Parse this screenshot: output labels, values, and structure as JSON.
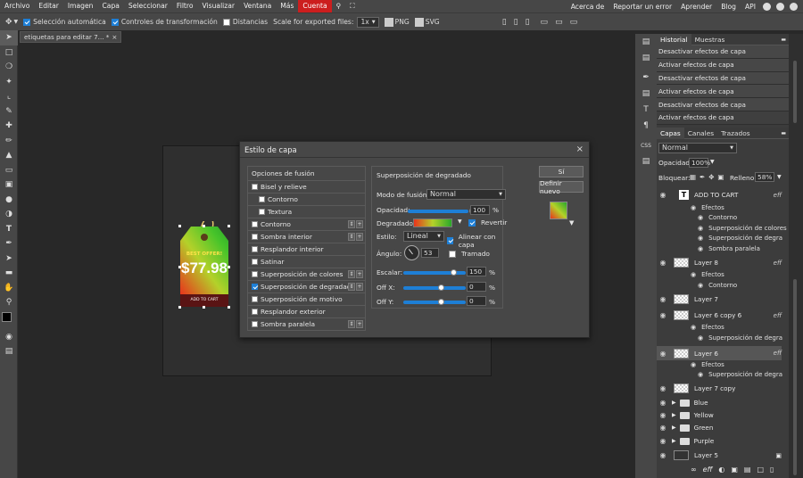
{
  "menu": [
    "Archivo",
    "Editar",
    "Imagen",
    "Capa",
    "Seleccionar",
    "Filtro",
    "Visualizar",
    "Ventana",
    "Más"
  ],
  "menu_highlight": "Cuenta",
  "menu_right": [
    "Acerca de",
    "Reportar un error",
    "Aprender",
    "Blog",
    "API"
  ],
  "options": {
    "auto_select": "Selección automática",
    "transform_controls": "Controles de transformación",
    "distances": "Distancias",
    "scale_label": "Scale for exported files:",
    "scale_value": "1x",
    "png": "PNG",
    "svg": "SVG"
  },
  "doc_tab": "etiquetas para editar 7... *",
  "doc_tab_close": "×",
  "dialog": {
    "title": "Estilo de capa",
    "close": "×",
    "left_header": "Opciones de fusión",
    "left_items": [
      {
        "label": "Bisel y relieve",
        "checked": false,
        "indent": false,
        "pm": false
      },
      {
        "label": "Contorno",
        "checked": false,
        "indent": true,
        "pm": false
      },
      {
        "label": "Textura",
        "checked": false,
        "indent": true,
        "pm": false
      },
      {
        "label": "Contorno",
        "checked": false,
        "indent": false,
        "pm": true
      },
      {
        "label": "Sombra interior",
        "checked": false,
        "indent": false,
        "pm": true
      },
      {
        "label": "Resplandor interior",
        "checked": false,
        "indent": false,
        "pm": false
      },
      {
        "label": "Satinar",
        "checked": false,
        "indent": false,
        "pm": false
      },
      {
        "label": "Superposición de colores",
        "checked": false,
        "indent": false,
        "pm": true
      },
      {
        "label": "Superposición de degradado",
        "checked": true,
        "indent": false,
        "pm": true
      },
      {
        "label": "Superposición de motivo",
        "checked": false,
        "indent": false,
        "pm": false
      },
      {
        "label": "Resplandor exterior",
        "checked": false,
        "indent": false,
        "pm": false
      },
      {
        "label": "Sombra paralela",
        "checked": false,
        "indent": false,
        "pm": true
      }
    ],
    "right_title": "Superposición de degradado",
    "blend_mode_label": "Modo de fusión:",
    "blend_mode_value": "Normal",
    "opacity_label": "Opacidad:",
    "opacity_value": "100",
    "percent": "%",
    "gradient_label": "Degradado:",
    "reverse_label": "Revertir",
    "style_label": "Estilo:",
    "style_value": "Lineal",
    "align_label": "Alinear con capa",
    "angle_label": "Ángulo:",
    "angle_value": "53",
    "dither_label": "Tramado",
    "scale_label": "Escalar:",
    "scale_value": "150",
    "offx_label": "Off X:",
    "offx_value": "0",
    "offy_label": "Off Y:",
    "offy_value": "0",
    "ok_button": "Sí",
    "default_button": "Definir nuevo"
  },
  "history": {
    "tabs": [
      "Historial",
      "Muestras"
    ],
    "items": [
      "Desactivar efectos de capa",
      "Activar efectos de capa",
      "Desactivar efectos de capa",
      "Activar efectos de capa",
      "Desactivar efectos de capa",
      "Activar efectos de capa"
    ]
  },
  "layers": {
    "tabs": [
      "Capas",
      "Canales",
      "Trazados"
    ],
    "blend": "Normal",
    "opacity_label": "Opacidad:",
    "opacity_value": "100%",
    "lock_label": "Bloquear:",
    "fill_label": "Relleno:",
    "fill_value": "58%",
    "fx": "eff",
    "effects_label": "Efectos",
    "add_to_cart": "ADD TO CART",
    "eff_contorno": "Contorno",
    "eff_sup_colores": "Superposición de colores",
    "eff_sup_degra": "Superposición de degra",
    "eff_sombra": "Sombra paralela",
    "layer8": "Layer 8",
    "layer8_eff": "Contorno",
    "layer7": "Layer 7",
    "layer6copy6": "Layer 6 copy 6",
    "layer6copy6_eff": "Superposición de degra",
    "layer6": "Layer 6",
    "layer6_eff": "Superposición de degra",
    "layer7copy": "Layer 7 copy",
    "folders": [
      "Blue",
      "Yellow",
      "Green",
      "Purple"
    ],
    "layer5": "Layer 5"
  },
  "tag": {
    "best": "BEST OFFER!",
    "price": "$77.98",
    "cart": "ADD TO CART"
  },
  "colors": {
    "accent": "#1e7fd6",
    "cuenta": "#cc1e1e"
  }
}
